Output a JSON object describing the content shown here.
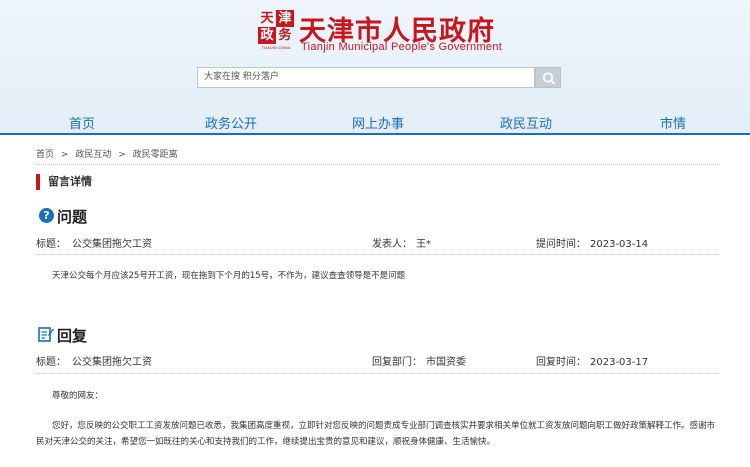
{
  "site": {
    "seal_chars": [
      "天",
      "津",
      "政",
      "务"
    ],
    "seal_sub": "TIANJIN·CHINA",
    "title": "天津市人民政府",
    "subtitle": "Tianjin Municipal People's Government",
    "brand_color": "#c8161d"
  },
  "search": {
    "value": "大家在搜 积分落户",
    "button_icon": "search-icon"
  },
  "nav": {
    "items": [
      "首页",
      "政务公开",
      "网上办事",
      "政民互动",
      "市情"
    ],
    "color": "#1a6fb9"
  },
  "breadcrumb": {
    "items": [
      "首页",
      ">",
      "政民互动",
      ">",
      "政民零距离"
    ]
  },
  "section": {
    "title": "留言详情"
  },
  "question": {
    "heading": "问题",
    "icon": "question-circle-icon",
    "title_label": "标题：",
    "title_value": "公交集团拖欠工资",
    "author_label": "发表人：",
    "author_value": "王*",
    "time_label": "提问时间：",
    "time_value": "2023-03-14",
    "content": "天津公交每个月应该25号开工资，现在拖到下个月的15号，不作为，建议查查领导是不是问题"
  },
  "reply": {
    "heading": "回复",
    "icon": "reply-document-icon",
    "title_label": "标题：",
    "title_value": "公交集团拖欠工资",
    "dept_label": "回复部门：",
    "dept_value": "市国资委",
    "time_label": "回复时间：",
    "time_value": "2023-03-17",
    "greeting": "尊敬的网友：",
    "content": "您好，您反映的公交职工工资发放问题已收悉，我集团高度重视，立即针对您反映的问题责成专业部门调查核实并要求相关单位就工资发放问题向职工做好政策解释工作。感谢市民对天津公交的关注，希望您一如既往的关心和支持我们的工作，继续提出宝贵的意见和建议，顺祝身体健康、生活愉快。"
  }
}
